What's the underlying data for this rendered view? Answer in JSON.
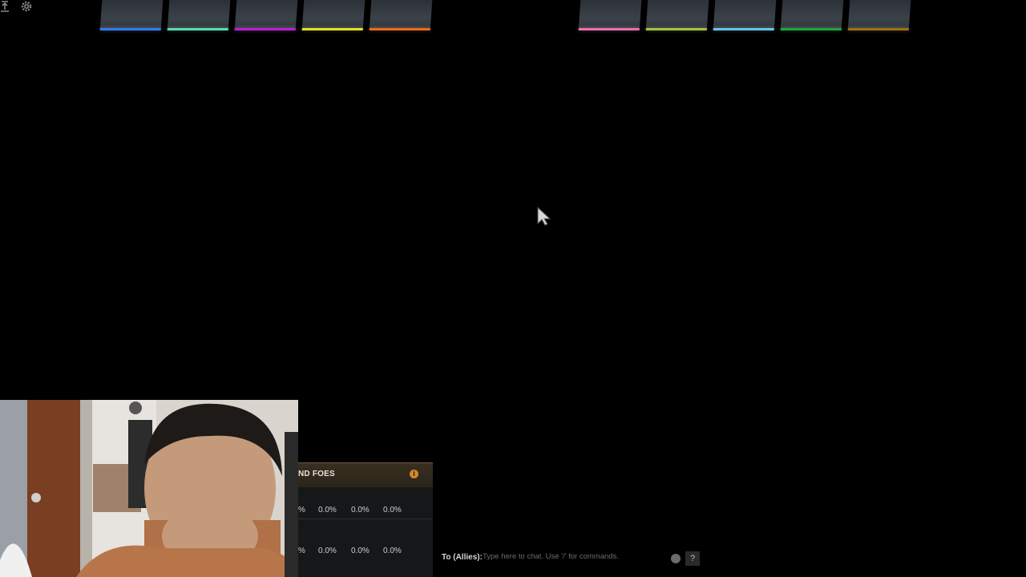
{
  "top_left": {
    "icons": [
      "upload-icon",
      "gear-icon"
    ]
  },
  "radiant": {
    "slots": [
      {
        "color": "#2f7bff"
      },
      {
        "color": "#50e0b0"
      },
      {
        "color": "#c01ad8"
      },
      {
        "color": "#e6e21a"
      },
      {
        "color": "#f06a12"
      }
    ]
  },
  "dire": {
    "slots": [
      {
        "color": "#f06bb0"
      },
      {
        "color": "#a4c23a"
      },
      {
        "color": "#5fc8e8"
      },
      {
        "color": "#18a838"
      },
      {
        "color": "#a0700f"
      }
    ]
  },
  "panel": {
    "title": "ND FOES",
    "info_icon": "info-icon",
    "rows": [
      [
        "%",
        "0.0%",
        "0.0%",
        "0.0%"
      ],
      [
        "%",
        "0.0%",
        "0.0%",
        "0.0%"
      ]
    ]
  },
  "chat": {
    "to_label": "To (Allies):",
    "placeholder": "Type here to chat. Use '/' for commands.",
    "help_label": "?"
  }
}
